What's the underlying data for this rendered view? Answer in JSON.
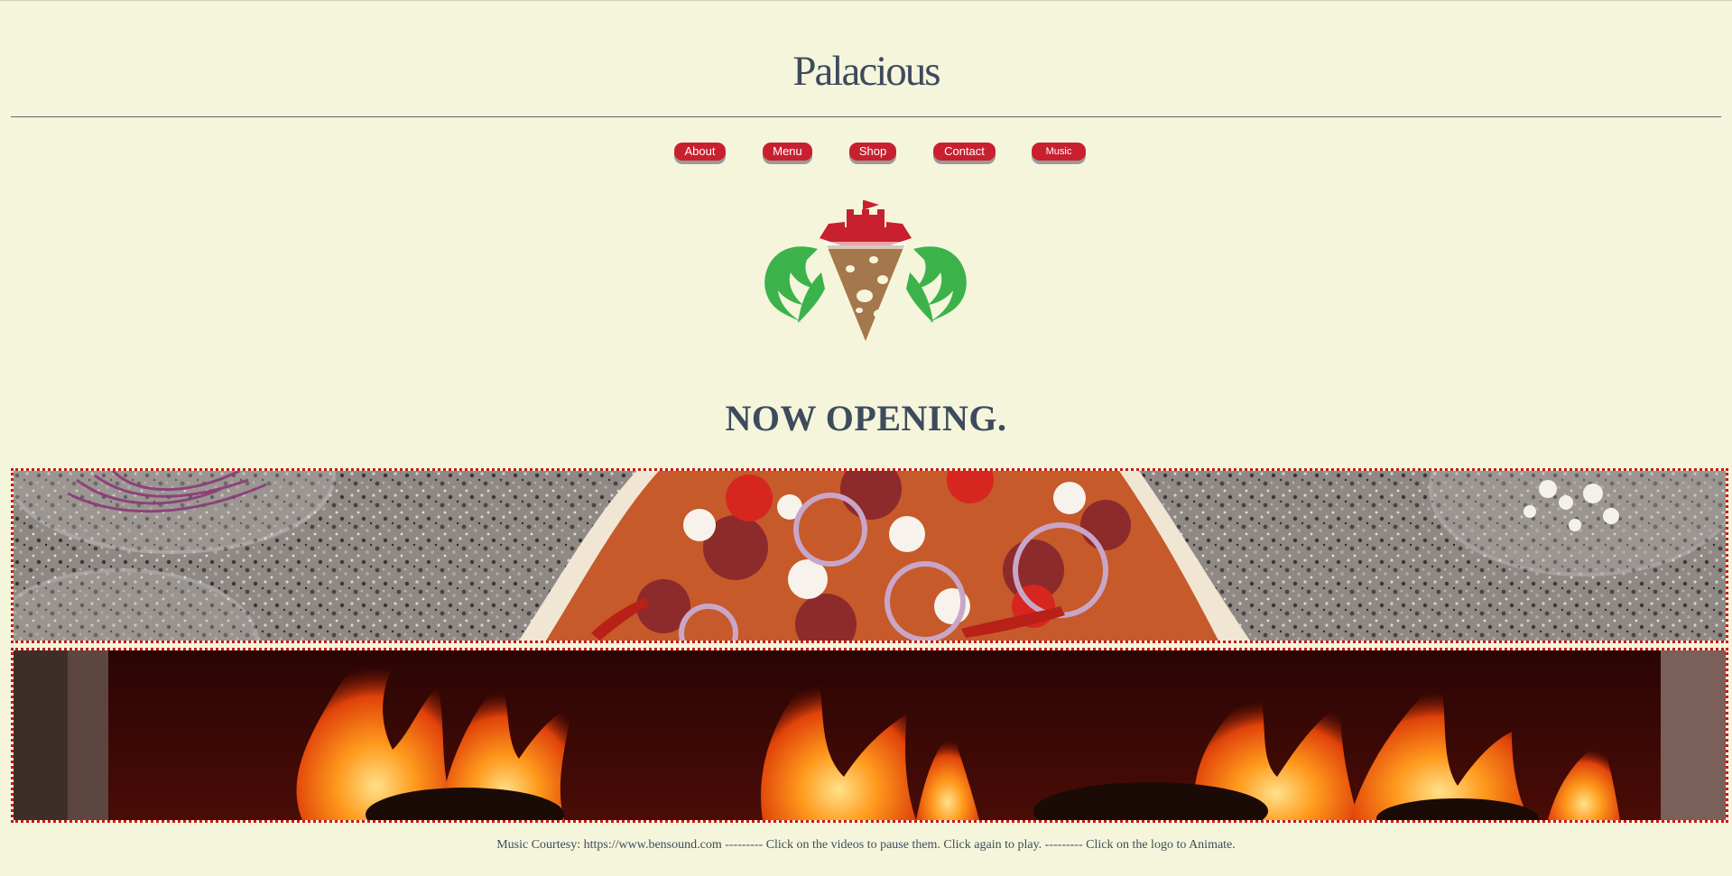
{
  "site": {
    "title": "Palacious"
  },
  "nav": {
    "items": [
      {
        "label": "About"
      },
      {
        "label": "Menu"
      },
      {
        "label": "Shop"
      },
      {
        "label": "Contact"
      },
      {
        "label": "Music"
      }
    ]
  },
  "hero": {
    "headline": "NOW OPENING."
  },
  "videos": [
    {
      "name": "pizza-preparation-video"
    },
    {
      "name": "wood-fire-video"
    }
  ],
  "footer": {
    "note": "Music Courtesy: https://www.bensound.com --------- Click on the videos to pause them. Click again to play. --------- Click on the logo to Animate."
  },
  "colors": {
    "background": "#f5f5dc",
    "text": "#3d4b5c",
    "accent_red": "#c8202f",
    "leaf_green": "#3bb34a",
    "crust_brown": "#a5774c"
  },
  "icons": {
    "logo": "castle-pizza-logo-icon"
  }
}
